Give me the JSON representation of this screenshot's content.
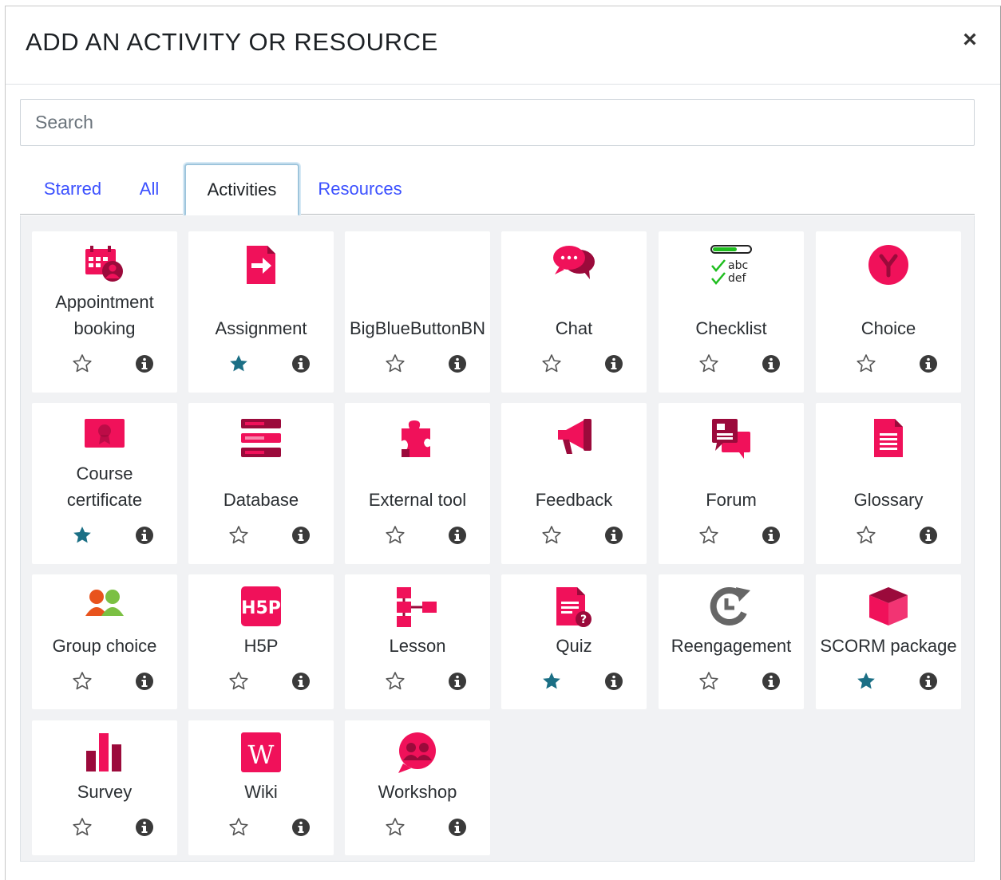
{
  "modal": {
    "title": "ADD AN ACTIVITY OR RESOURCE",
    "close_label": "×"
  },
  "search": {
    "placeholder": "Search",
    "value": ""
  },
  "tabs": [
    {
      "label": "Starred",
      "active": false
    },
    {
      "label": "All",
      "active": false
    },
    {
      "label": "Activities",
      "active": true
    },
    {
      "label": "Resources",
      "active": false
    }
  ],
  "colors": {
    "icon": "#f0115a",
    "icon_dark": "#9b0a3b",
    "starred": "#1b6f85",
    "tab_link": "#3b50ff"
  },
  "items": [
    {
      "label": "Appointment booking",
      "lines": [
        "Appointment",
        "booking"
      ],
      "starred": false,
      "icon": "calendar-person-icon"
    },
    {
      "label": "Assignment",
      "lines": [
        "Assignment"
      ],
      "starred": true,
      "icon": "assignment-icon"
    },
    {
      "label": "BigBlueButtonBN",
      "lines": [
        "BigBlueButtonBN"
      ],
      "starred": false,
      "icon": ""
    },
    {
      "label": "Chat",
      "lines": [
        "Chat"
      ],
      "starred": false,
      "icon": "chat-icon"
    },
    {
      "label": "Checklist",
      "lines": [
        "Checklist"
      ],
      "starred": false,
      "icon": "checklist-icon"
    },
    {
      "label": "Choice",
      "lines": [
        "Choice"
      ],
      "starred": false,
      "icon": "choice-icon"
    },
    {
      "label": "Course certificate",
      "lines": [
        "Course",
        "certificate"
      ],
      "starred": true,
      "icon": "certificate-icon"
    },
    {
      "label": "Database",
      "lines": [
        "Database"
      ],
      "starred": false,
      "icon": "database-icon"
    },
    {
      "label": "External tool",
      "lines": [
        "External tool"
      ],
      "starred": false,
      "icon": "puzzle-icon"
    },
    {
      "label": "Feedback",
      "lines": [
        "Feedback"
      ],
      "starred": false,
      "icon": "megaphone-icon"
    },
    {
      "label": "Forum",
      "lines": [
        "Forum"
      ],
      "starred": false,
      "icon": "forum-icon"
    },
    {
      "label": "Glossary",
      "lines": [
        "Glossary"
      ],
      "starred": false,
      "icon": "glossary-icon"
    },
    {
      "label": "Group choice",
      "lines": [
        "Group choice"
      ],
      "starred": false,
      "icon": "group-choice-icon"
    },
    {
      "label": "H5P",
      "lines": [
        "H5P"
      ],
      "starred": false,
      "icon": "h5p-icon"
    },
    {
      "label": "Lesson",
      "lines": [
        "Lesson"
      ],
      "starred": false,
      "icon": "lesson-icon"
    },
    {
      "label": "Quiz",
      "lines": [
        "Quiz"
      ],
      "starred": true,
      "icon": "quiz-icon"
    },
    {
      "label": "Reengagement",
      "lines": [
        "Reengagement"
      ],
      "starred": false,
      "icon": "reengagement-icon"
    },
    {
      "label": "SCORM package",
      "lines": [
        "SCORM package"
      ],
      "starred": true,
      "icon": "scorm-icon"
    },
    {
      "label": "Survey",
      "lines": [
        "Survey"
      ],
      "starred": false,
      "icon": "survey-icon"
    },
    {
      "label": "Wiki",
      "lines": [
        "Wiki"
      ],
      "starred": false,
      "icon": "wiki-icon"
    },
    {
      "label": "Workshop",
      "lines": [
        "Workshop"
      ],
      "starred": false,
      "icon": "workshop-icon"
    }
  ]
}
